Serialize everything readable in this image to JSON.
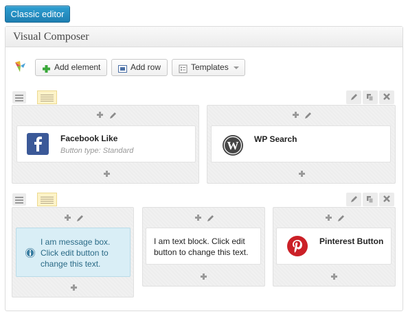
{
  "header": {
    "classic_editor_label": "Classic editor"
  },
  "panel": {
    "title": "Visual Composer"
  },
  "toolbar": {
    "add_element_label": "Add element",
    "add_row_label": "Add row",
    "templates_label": "Templates"
  },
  "rows": [
    {
      "columns": [
        {
          "element": {
            "title": "Facebook Like",
            "subtitle": "Button type: Standard",
            "icon": "facebook-icon"
          }
        },
        {
          "element": {
            "title": "WP Search",
            "icon": "wordpress-icon"
          }
        }
      ]
    },
    {
      "columns": [
        {
          "element": {
            "type": "message",
            "text": "I am message box. Click edit button to change this text.",
            "icon": "info-icon"
          }
        },
        {
          "element": {
            "type": "text",
            "text": "I am text block. Click edit button to change this text."
          }
        },
        {
          "element": {
            "title": "Pinterest Button",
            "icon": "pinterest-icon"
          }
        }
      ]
    }
  ],
  "colors": {
    "accent": "#2e9fd2",
    "message_bg": "#d9eef6",
    "facebook": "#3b5998",
    "pinterest": "#cb2027"
  }
}
